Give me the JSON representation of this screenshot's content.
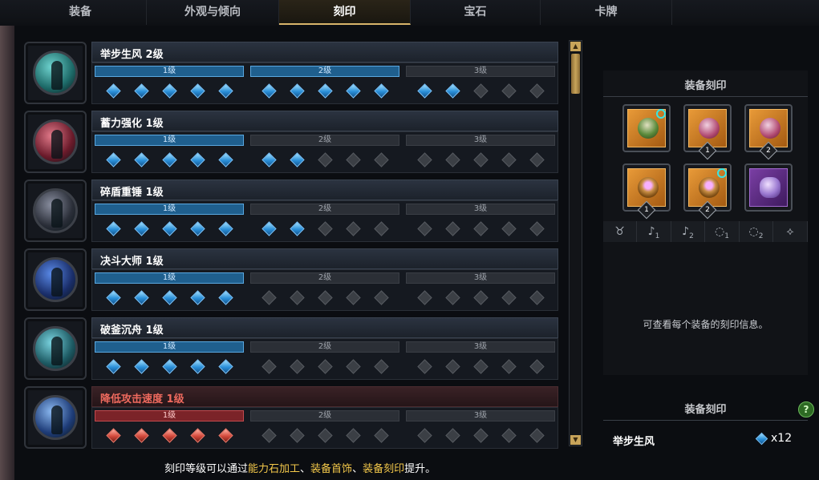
{
  "tabs": [
    {
      "label": "装备",
      "active": false
    },
    {
      "label": "外观与倾向",
      "active": false
    },
    {
      "label": "刻印",
      "active": true
    },
    {
      "label": "宝石",
      "active": false
    },
    {
      "label": "卡牌",
      "active": false
    }
  ],
  "engravings": [
    {
      "name": "举步生风 2级",
      "negative": false,
      "active_level": 2,
      "levels": [
        {
          "label": "1级",
          "filled": 5
        },
        {
          "label": "2级",
          "filled": 5
        },
        {
          "label": "3级",
          "filled": 2
        }
      ]
    },
    {
      "name": "蓄力强化 1级",
      "negative": false,
      "active_level": 1,
      "levels": [
        {
          "label": "1级",
          "filled": 5
        },
        {
          "label": "2级",
          "filled": 2
        },
        {
          "label": "3级",
          "filled": 0
        }
      ]
    },
    {
      "name": "碎盾重锤 1级",
      "negative": false,
      "active_level": 1,
      "levels": [
        {
          "label": "1级",
          "filled": 5
        },
        {
          "label": "2级",
          "filled": 2
        },
        {
          "label": "3级",
          "filled": 0
        }
      ]
    },
    {
      "name": "决斗大师 1级",
      "negative": false,
      "active_level": 1,
      "levels": [
        {
          "label": "1级",
          "filled": 5
        },
        {
          "label": "2级",
          "filled": 0
        },
        {
          "label": "3级",
          "filled": 0
        }
      ]
    },
    {
      "name": "破釜沉舟 1级",
      "negative": false,
      "active_level": 1,
      "levels": [
        {
          "label": "1级",
          "filled": 5
        },
        {
          "label": "2级",
          "filled": 0
        },
        {
          "label": "3级",
          "filled": 0
        }
      ]
    },
    {
      "name": "降低攻击速度 1级",
      "negative": true,
      "active_level": 1,
      "levels": [
        {
          "label": "1级",
          "filled": 5
        },
        {
          "label": "2级",
          "filled": 0
        },
        {
          "label": "3级",
          "filled": 0
        }
      ]
    }
  ],
  "footer": {
    "prefix": "刻印等级可以通过",
    "h1": "能力石加工",
    "sep1": "、",
    "h2": "装备首饰",
    "sep2": "、",
    "h3": "装备刻印",
    "suffix": "提升。"
  },
  "right_panel": {
    "title": "装备刻印",
    "slots": [
      {
        "icon": "necklace-icon",
        "badge": "",
        "plus": true,
        "style": "orange",
        "kind": "neck"
      },
      {
        "icon": "earring-icon",
        "badge": "1",
        "plus": false,
        "style": "orange",
        "kind": "ear"
      },
      {
        "icon": "earring-icon",
        "badge": "2",
        "plus": false,
        "style": "orange",
        "kind": "ear"
      },
      {
        "icon": "ring-icon",
        "badge": "1",
        "plus": false,
        "style": "orange",
        "kind": "ring"
      },
      {
        "icon": "ring-icon",
        "badge": "2",
        "plus": true,
        "style": "orange",
        "kind": "ring"
      },
      {
        "icon": "ability-stone-icon",
        "badge": "",
        "plus": false,
        "style": "purple",
        "kind": "stone"
      }
    ],
    "filter_icons": [
      {
        "name": "necklace-filter-icon",
        "glyph": "♉",
        "sub": ""
      },
      {
        "name": "earring-1-filter-icon",
        "glyph": "♪",
        "sub": "1"
      },
      {
        "name": "earring-2-filter-icon",
        "glyph": "♪",
        "sub": "2"
      },
      {
        "name": "ring-1-filter-icon",
        "glyph": "◌",
        "sub": "1"
      },
      {
        "name": "ring-2-filter-icon",
        "glyph": "◌",
        "sub": "2"
      },
      {
        "name": "stone-filter-icon",
        "glyph": "⟡",
        "sub": ""
      }
    ],
    "info": "可查看每个装备的刻印信息。"
  },
  "equipped": {
    "title": "装备刻印",
    "help": "?",
    "item_name": "举步生风",
    "count": "x12"
  }
}
